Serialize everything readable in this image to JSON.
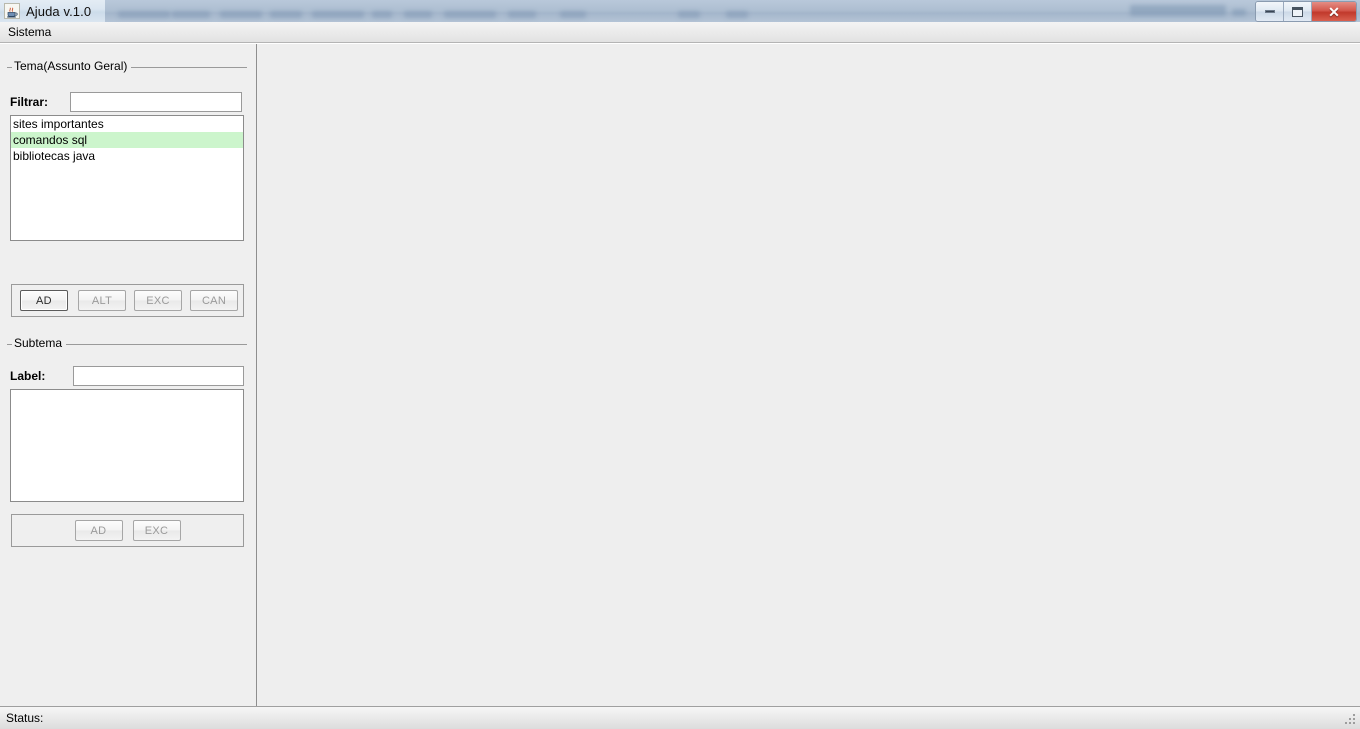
{
  "window": {
    "title": "Ajuda v.1.0",
    "app_icon": "java-coffee-cup-icon",
    "buttons": {
      "minimize": "minimize-icon",
      "maximize": "maximize-icon",
      "close": "✕"
    }
  },
  "menubar": {
    "items": [
      {
        "label": "Sistema"
      }
    ]
  },
  "tema_group": {
    "title": "Tema(Assunto Geral)",
    "filter_label": "Filtrar:",
    "filter_value": "",
    "filter_placeholder": "",
    "list_items": [
      {
        "label": "sites importantes",
        "selected": false
      },
      {
        "label": "comandos sql",
        "selected": true
      },
      {
        "label": "bibliotecas java",
        "selected": false
      }
    ],
    "selection_color": "#ccf5cc",
    "buttons": [
      {
        "label": "AD",
        "enabled": true,
        "focused": true
      },
      {
        "label": "ALT",
        "enabled": false,
        "focused": false
      },
      {
        "label": "EXC",
        "enabled": false,
        "focused": false
      },
      {
        "label": "CAN",
        "enabled": false,
        "focused": false
      }
    ]
  },
  "subtema_group": {
    "title": "Subtema",
    "label_label": "Label:",
    "label_value": "",
    "label_placeholder": "",
    "list_items": [],
    "buttons": [
      {
        "label": "AD",
        "enabled": false,
        "focused": false
      },
      {
        "label": "EXC",
        "enabled": false,
        "focused": false
      }
    ]
  },
  "main_panel": {
    "content": "",
    "background": "#eeeeee"
  },
  "statusbar": {
    "label": "Status:",
    "value": ""
  }
}
